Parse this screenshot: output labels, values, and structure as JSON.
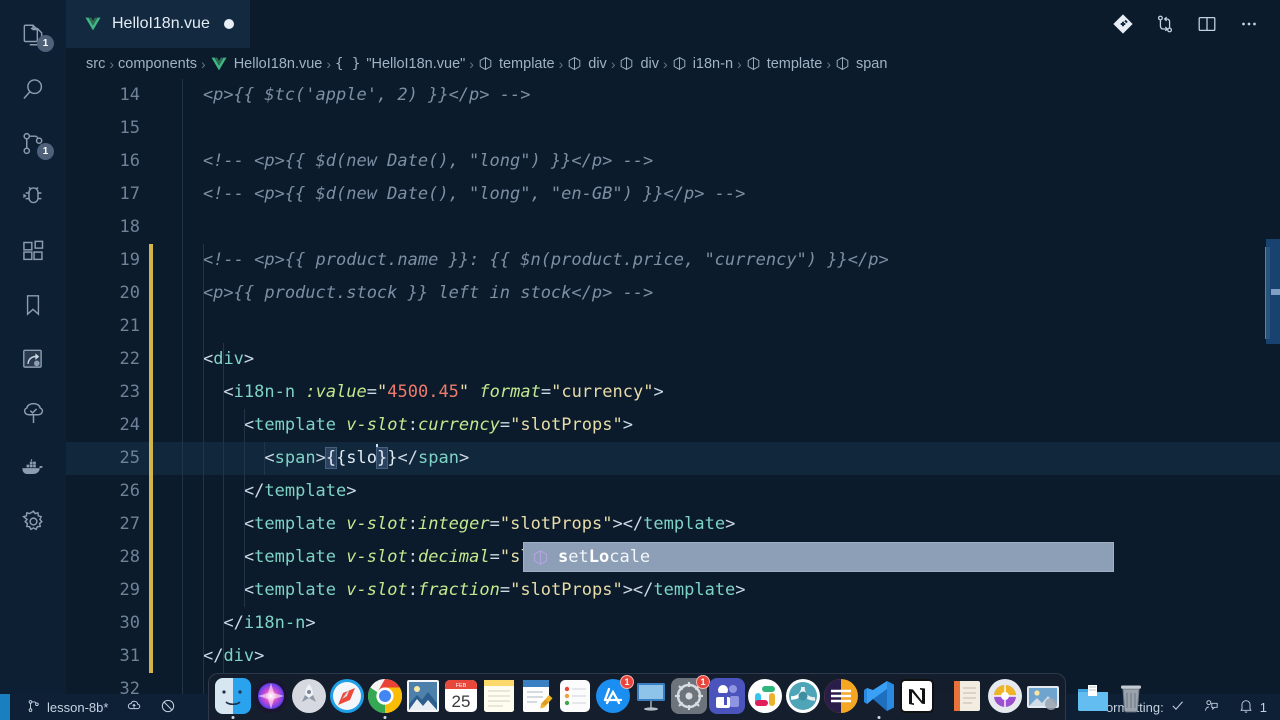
{
  "window": {
    "app": "Visual Studio Code",
    "theme_bg": "#0b1b2b"
  },
  "activity_bar": {
    "items": [
      {
        "name": "explorer",
        "icon": "files-icon",
        "badge": "1"
      },
      {
        "name": "search",
        "icon": "search-icon",
        "badge": ""
      },
      {
        "name": "source-control",
        "icon": "source-control-icon",
        "badge": "1"
      },
      {
        "name": "run-and-debug",
        "icon": "debug-icon",
        "badge": ""
      },
      {
        "name": "extensions",
        "icon": "extensions-icon",
        "badge": ""
      },
      {
        "name": "bookmarks",
        "icon": "bookmark-icon",
        "badge": ""
      },
      {
        "name": "live-share",
        "icon": "live-share-icon",
        "badge": ""
      },
      {
        "name": "test-explorer",
        "icon": "tree-icon",
        "badge": ""
      },
      {
        "name": "docker",
        "icon": "docker-whale-icon",
        "badge": ""
      },
      {
        "name": "settings",
        "icon": "gear-icon",
        "badge": ""
      }
    ]
  },
  "tabs": [
    {
      "label": "HelloI18n.vue",
      "icon": "vue-file-icon",
      "dirty": true,
      "active": true
    }
  ],
  "editor_actions": [
    {
      "name": "source-control-diamond",
      "icon": "git-diamond-icon"
    },
    {
      "name": "compare-changes",
      "icon": "compare-changes-icon"
    },
    {
      "name": "split-editor-right",
      "icon": "split-editor-icon"
    },
    {
      "name": "more-actions",
      "icon": "ellipsis-icon"
    }
  ],
  "breadcrumbs": [
    {
      "label": "src",
      "icon": ""
    },
    {
      "label": "components",
      "icon": ""
    },
    {
      "label": "HelloI18n.vue",
      "icon": "vue-file-icon"
    },
    {
      "label": "\"HelloI18n.vue\"",
      "icon": "braces-icon"
    },
    {
      "label": "template",
      "icon": "symbol-cube-icon"
    },
    {
      "label": "div",
      "icon": "symbol-cube-icon"
    },
    {
      "label": "div",
      "icon": "symbol-cube-icon"
    },
    {
      "label": "i18n-n",
      "icon": "symbol-cube-icon"
    },
    {
      "label": "template",
      "icon": "symbol-cube-icon"
    },
    {
      "label": "span",
      "icon": "symbol-cube-icon"
    }
  ],
  "code": {
    "language": "vue",
    "first_visible_line": 14,
    "cursor": {
      "line": 25,
      "column": 17
    },
    "lines": [
      {
        "num": "14",
        "clipped": true,
        "modified": false,
        "tokens": [
          {
            "t": "comment",
            "s": "    <p>{{ $tc('apple', 2) }}</p> -->"
          }
        ]
      },
      {
        "num": "15",
        "modified": false,
        "tokens": [
          {
            "t": "plain",
            "s": ""
          }
        ]
      },
      {
        "num": "16",
        "modified": false,
        "tokens": [
          {
            "t": "comment",
            "s": "····<!--·<p>{{·$d(new·Date(),·\"long\")·}}</p>·-->"
          }
        ]
      },
      {
        "num": "17",
        "modified": false,
        "tokens": [
          {
            "t": "comment",
            "s": "····<!--·<p>{{·$d(new·Date(),·\"long\",·\"en-GB\")·}}</p>·-->"
          }
        ]
      },
      {
        "num": "18",
        "modified": false,
        "tokens": [
          {
            "t": "plain",
            "s": ""
          }
        ]
      },
      {
        "num": "19",
        "modified": true,
        "tokens": [
          {
            "t": "comment",
            "s": "····<!--·<p>{{·product.name·}}:·{{·$n(product.price,·\"currency\")·}}</p>"
          }
        ]
      },
      {
        "num": "20",
        "modified": true,
        "tokens": [
          {
            "t": "comment",
            "s": "····<p>{{·product.stock·}}·left·in·stock</p>·-->"
          }
        ]
      },
      {
        "num": "21",
        "modified": true,
        "tokens": [
          {
            "t": "plain",
            "s": ""
          }
        ]
      },
      {
        "num": "22",
        "modified": true,
        "tokens": [
          {
            "t": "plain",
            "s": "····"
          },
          {
            "t": "punct",
            "s": "<"
          },
          {
            "t": "tag",
            "s": "div"
          },
          {
            "t": "punct",
            "s": ">"
          }
        ]
      },
      {
        "num": "23",
        "modified": true,
        "tokens": [
          {
            "t": "plain",
            "s": "······"
          },
          {
            "t": "punct",
            "s": "<"
          },
          {
            "t": "tag",
            "s": "i18n-n"
          },
          {
            "t": "plain",
            "s": " "
          },
          {
            "t": "attr",
            "s": ":value"
          },
          {
            "t": "punct",
            "s": "="
          },
          {
            "t": "str",
            "s": "\""
          },
          {
            "t": "num",
            "s": "4500.45"
          },
          {
            "t": "str",
            "s": "\""
          },
          {
            "t": "plain",
            "s": " "
          },
          {
            "t": "attr",
            "s": "format"
          },
          {
            "t": "punct",
            "s": "="
          },
          {
            "t": "str",
            "s": "\"currency\""
          },
          {
            "t": "punct",
            "s": ">"
          }
        ]
      },
      {
        "num": "24",
        "modified": true,
        "tokens": [
          {
            "t": "plain",
            "s": "········"
          },
          {
            "t": "punct",
            "s": "<"
          },
          {
            "t": "tag",
            "s": "template"
          },
          {
            "t": "plain",
            "s": " "
          },
          {
            "t": "attr",
            "s": "v-slot"
          },
          {
            "t": "punct",
            "s": ":"
          },
          {
            "t": "attr",
            "s": "currency"
          },
          {
            "t": "punct",
            "s": "="
          },
          {
            "t": "str",
            "s": "\"slotProps\""
          },
          {
            "t": "punct",
            "s": ">"
          }
        ]
      },
      {
        "num": "25",
        "modified": true,
        "current": true,
        "tokens": [
          {
            "t": "plain",
            "s": "··········"
          },
          {
            "t": "punct",
            "s": "<"
          },
          {
            "t": "tag",
            "s": "span"
          },
          {
            "t": "punct",
            "s": ">"
          },
          {
            "t": "mustache-open",
            "s": "{"
          },
          {
            "t": "mustache",
            "s": "{slo"
          },
          {
            "t": "cursor",
            "s": ""
          },
          {
            "t": "mustache-close",
            "s": "}"
          },
          {
            "t": "mustache",
            "s": "}"
          },
          {
            "t": "punct",
            "s": "</"
          },
          {
            "t": "tag",
            "s": "span"
          },
          {
            "t": "punct",
            "s": ">"
          }
        ]
      },
      {
        "num": "26",
        "modified": true,
        "tokens": [
          {
            "t": "plain",
            "s": "········"
          },
          {
            "t": "punct",
            "s": "</"
          },
          {
            "t": "tag",
            "s": "template"
          },
          {
            "t": "punct",
            "s": ">"
          }
        ]
      },
      {
        "num": "27",
        "modified": true,
        "tokens": [
          {
            "t": "plain",
            "s": "········"
          },
          {
            "t": "punct",
            "s": "<"
          },
          {
            "t": "tag",
            "s": "template"
          },
          {
            "t": "plain",
            "s": " "
          },
          {
            "t": "attr",
            "s": "v-slot"
          },
          {
            "t": "punct",
            "s": ":"
          },
          {
            "t": "attr",
            "s": "integer"
          },
          {
            "t": "punct",
            "s": "="
          },
          {
            "t": "str",
            "s": "\"slotProps\""
          },
          {
            "t": "punct",
            "s": "></"
          },
          {
            "t": "tag",
            "s": "template"
          },
          {
            "t": "punct",
            "s": ">"
          }
        ]
      },
      {
        "num": "28",
        "modified": true,
        "tokens": [
          {
            "t": "plain",
            "s": "········"
          },
          {
            "t": "punct",
            "s": "<"
          },
          {
            "t": "tag",
            "s": "template"
          },
          {
            "t": "plain",
            "s": " "
          },
          {
            "t": "attr",
            "s": "v-slot"
          },
          {
            "t": "punct",
            "s": ":"
          },
          {
            "t": "attr",
            "s": "decimal"
          },
          {
            "t": "punct",
            "s": "="
          },
          {
            "t": "str",
            "s": "\"slotProps\""
          },
          {
            "t": "punct",
            "s": "></"
          },
          {
            "t": "tag",
            "s": "template"
          },
          {
            "t": "punct",
            "s": ">"
          }
        ]
      },
      {
        "num": "29",
        "modified": true,
        "tokens": [
          {
            "t": "plain",
            "s": "········"
          },
          {
            "t": "punct",
            "s": "<"
          },
          {
            "t": "tag",
            "s": "template"
          },
          {
            "t": "plain",
            "s": " "
          },
          {
            "t": "attr",
            "s": "v-slot"
          },
          {
            "t": "punct",
            "s": ":"
          },
          {
            "t": "attr",
            "s": "fraction"
          },
          {
            "t": "punct",
            "s": "="
          },
          {
            "t": "str",
            "s": "\"slotProps\""
          },
          {
            "t": "punct",
            "s": "></"
          },
          {
            "t": "tag",
            "s": "template"
          },
          {
            "t": "punct",
            "s": ">"
          }
        ]
      },
      {
        "num": "30",
        "modified": true,
        "tokens": [
          {
            "t": "plain",
            "s": "······"
          },
          {
            "t": "punct",
            "s": "</"
          },
          {
            "t": "tag",
            "s": "i18n-n"
          },
          {
            "t": "punct",
            "s": ">"
          }
        ]
      },
      {
        "num": "31",
        "modified": true,
        "tokens": [
          {
            "t": "plain",
            "s": "····"
          },
          {
            "t": "punct",
            "s": "</"
          },
          {
            "t": "tag",
            "s": "div"
          },
          {
            "t": "punct",
            "s": ">"
          }
        ]
      },
      {
        "num": "32",
        "modified": false,
        "tokens": [
          {
            "t": "plain",
            "s": ""
          }
        ]
      }
    ]
  },
  "suggestion": {
    "visible": true,
    "icon": "symbol-cube-icon",
    "items": [
      {
        "label": "setLocale",
        "match_prefix": "s",
        "match_mid": "Lo",
        "selected": true
      }
    ],
    "rendered": {
      "a": "s",
      "b": "et",
      "c": "Lo",
      "d": "cale"
    }
  },
  "status_bar": {
    "left": [
      {
        "name": "remote-indicator",
        "label": ""
      },
      {
        "name": "branch",
        "icon": "git-branch-icon",
        "label": "lesson-8b*"
      },
      {
        "name": "sync-changes",
        "icon": "cloud-upload-icon",
        "label": ""
      },
      {
        "name": "error-indicator",
        "icon": "circle-slash-icon",
        "label": ""
      }
    ],
    "right": [
      {
        "name": "formatting-status",
        "label": "ormatting:",
        "icon": "check-icon"
      },
      {
        "name": "feedback",
        "icon": "feedback-icon",
        "label": ""
      },
      {
        "name": "notifications",
        "icon": "bell-icon",
        "label": "1"
      }
    ]
  },
  "dock": {
    "items": [
      {
        "name": "finder",
        "label": "Finder",
        "badge": "",
        "running": true
      },
      {
        "name": "siri",
        "label": "Siri",
        "badge": "",
        "running": false
      },
      {
        "name": "launchpad",
        "label": "Launchpad",
        "badge": "",
        "running": false
      },
      {
        "name": "safari",
        "label": "Safari",
        "badge": "",
        "running": false
      },
      {
        "name": "chrome",
        "label": "Google Chrome",
        "badge": "",
        "running": true
      },
      {
        "name": "preview",
        "label": "Preview",
        "badge": "",
        "running": false
      },
      {
        "name": "calendar",
        "label": "Calendar",
        "badge": "",
        "running": false,
        "day": "25",
        "month": "FEB"
      },
      {
        "name": "notes",
        "label": "Notes",
        "badge": "",
        "running": false
      },
      {
        "name": "textedit",
        "label": "TextEdit",
        "badge": "",
        "running": false
      },
      {
        "name": "reminders",
        "label": "Reminders",
        "badge": "",
        "running": false
      },
      {
        "name": "app-store",
        "label": "App Store",
        "badge": "1",
        "running": false
      },
      {
        "name": "keynote",
        "label": "Keynote",
        "badge": "",
        "running": false
      },
      {
        "name": "system-preferences",
        "label": "System Preferences",
        "badge": "1",
        "running": false
      },
      {
        "name": "microsoft-teams",
        "label": "Microsoft Teams",
        "badge": "",
        "running": false
      },
      {
        "name": "slack",
        "label": "Slack",
        "badge": "",
        "running": false
      },
      {
        "name": "sourcetree",
        "label": "Sourcetree",
        "badge": "",
        "running": false
      },
      {
        "name": "zeplin",
        "label": "Zeplin",
        "badge": "",
        "running": false
      },
      {
        "name": "vscode",
        "label": "Visual Studio Code",
        "badge": "",
        "running": true
      },
      {
        "name": "notion",
        "label": "Notion",
        "badge": "",
        "running": false
      },
      {
        "name": "separator-1",
        "label": "",
        "badge": "",
        "running": false
      },
      {
        "name": "notebook",
        "label": "Notebook",
        "badge": "",
        "running": false
      },
      {
        "name": "imovie",
        "label": "iMovie",
        "badge": "",
        "running": false
      },
      {
        "name": "photos-folder",
        "label": "Pictures",
        "badge": "",
        "running": false
      },
      {
        "name": "separator-2",
        "label": "",
        "badge": "",
        "running": false
      },
      {
        "name": "downloads",
        "label": "Downloads",
        "badge": "",
        "running": false
      },
      {
        "name": "trash",
        "label": "Trash",
        "badge": "",
        "running": false
      }
    ]
  }
}
